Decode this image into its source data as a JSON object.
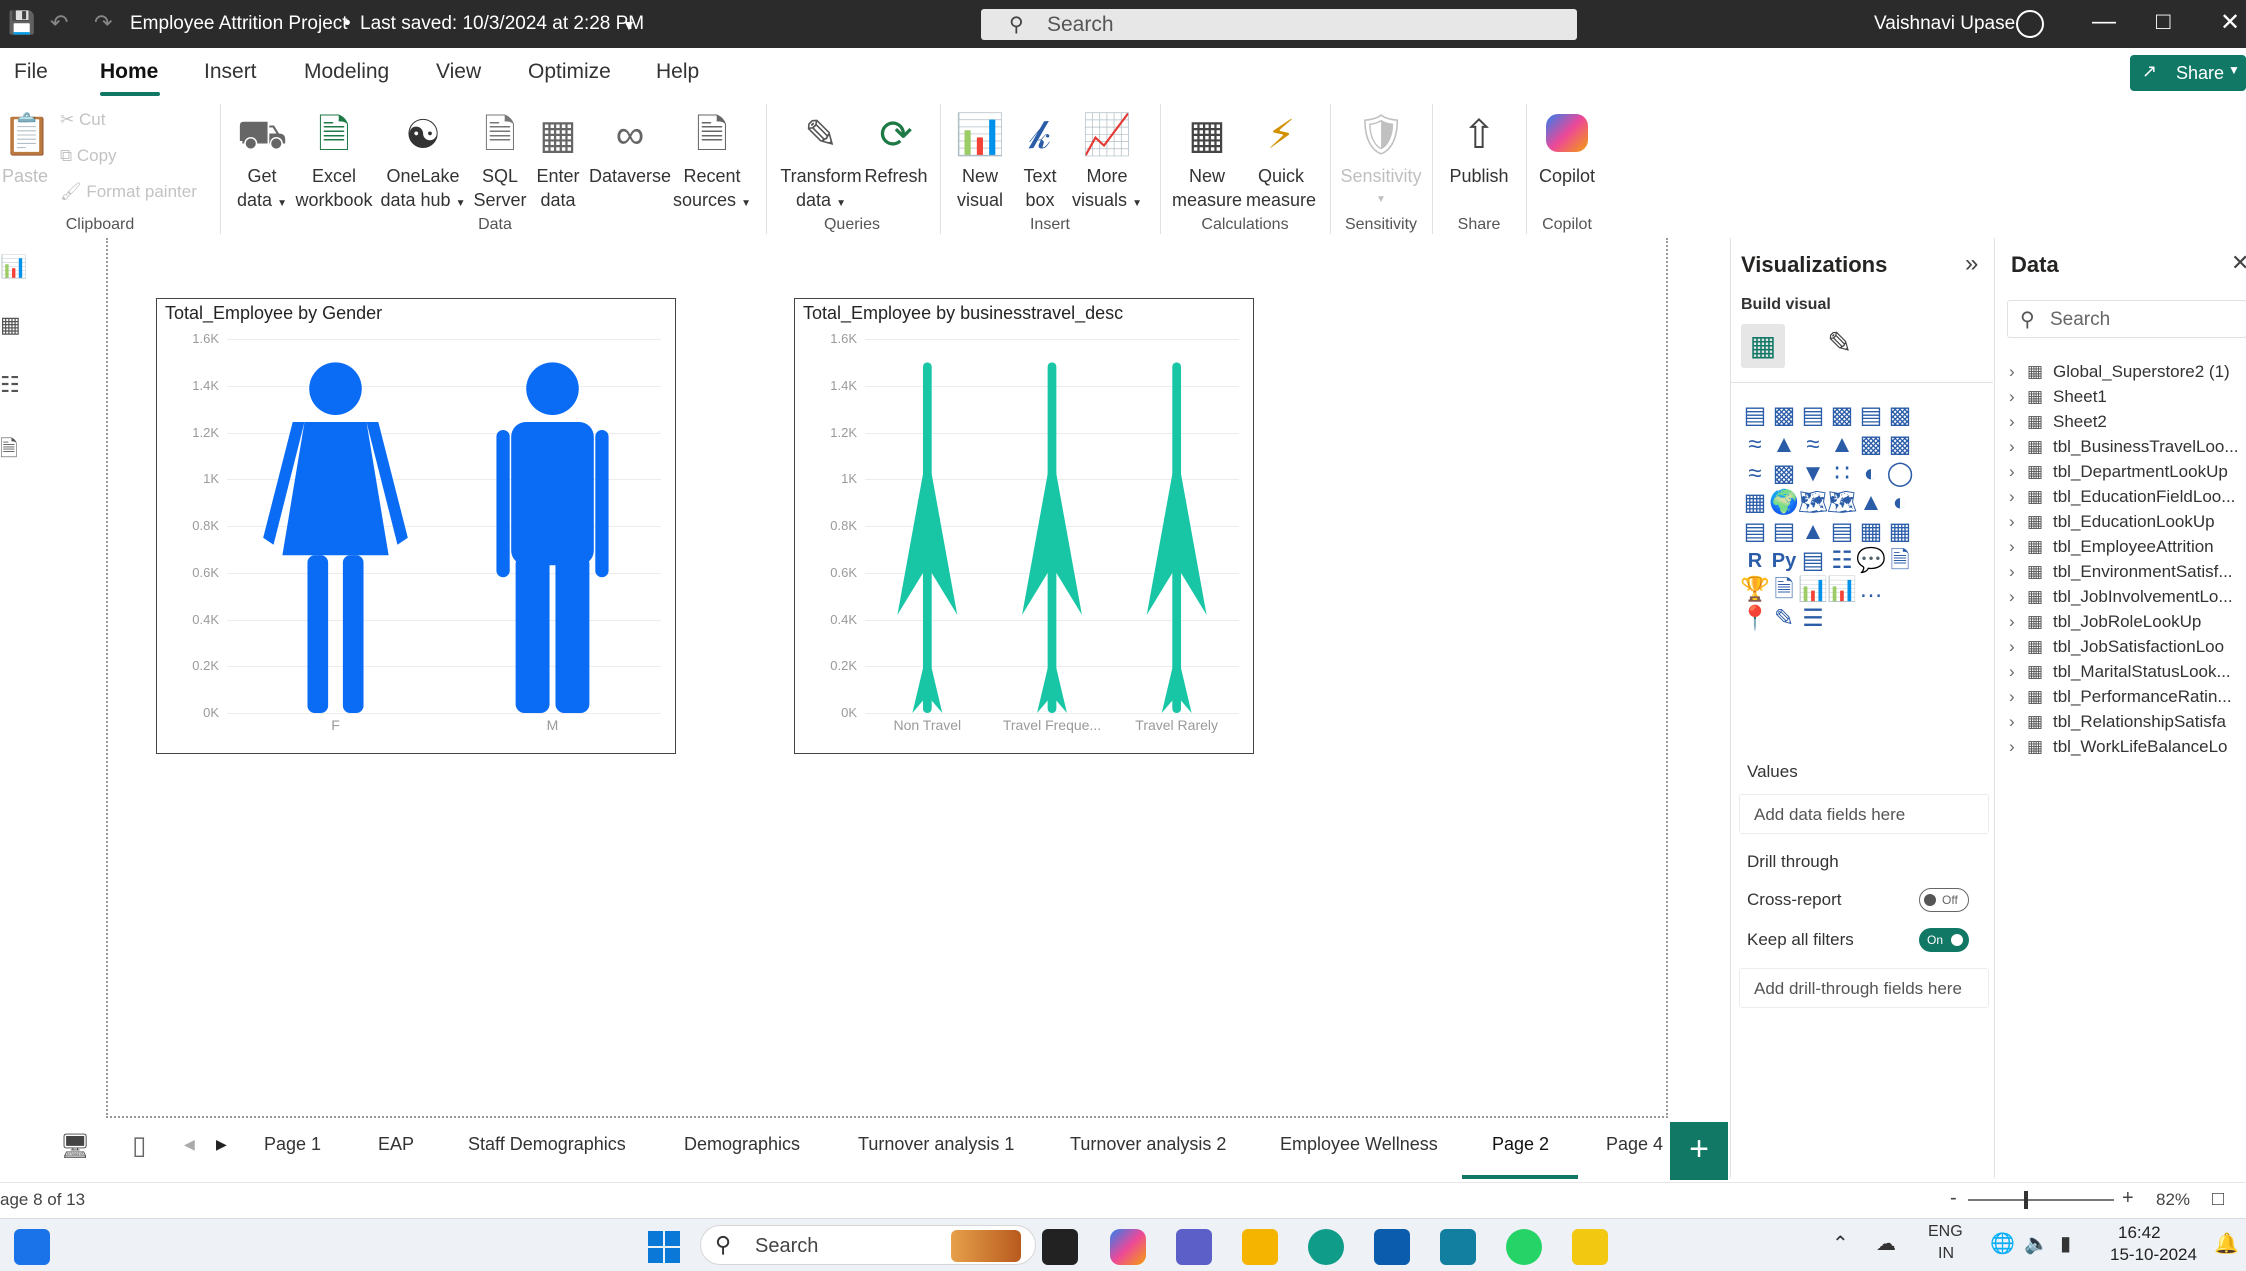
{
  "titlebar": {
    "document_title": "Employee Attrition Project",
    "saved_status": "Last saved: 10/3/2024 at 2:28 PM",
    "search_placeholder": "Search",
    "user_name": "Vaishnavi Upase"
  },
  "menu": {
    "items": [
      "File",
      "Home",
      "Insert",
      "Modeling",
      "View",
      "Optimize",
      "Help"
    ],
    "share_label": "Share"
  },
  "ribbon": {
    "clipboard": {
      "paste": "Paste",
      "cut": "Cut",
      "copy": "Copy",
      "format_painter": "Format painter",
      "group": "Clipboard"
    },
    "data": {
      "get_data": [
        "Get",
        "data"
      ],
      "excel": [
        "Excel",
        "workbook"
      ],
      "onelake": [
        "OneLake",
        "data hub"
      ],
      "sql": [
        "SQL",
        "Server"
      ],
      "enter": [
        "Enter",
        "data"
      ],
      "dataverse": [
        "Dataverse",
        ""
      ],
      "recent": [
        "Recent",
        "sources"
      ],
      "group": "Data"
    },
    "queries": {
      "transform": [
        "Transform",
        "data"
      ],
      "refresh": [
        "Refresh",
        ""
      ],
      "group": "Queries"
    },
    "insert": {
      "new_visual": [
        "New",
        "visual"
      ],
      "text_box": [
        "Text",
        "box"
      ],
      "more_visuals": [
        "More",
        "visuals"
      ],
      "group": "Insert"
    },
    "calculations": {
      "new_measure": [
        "New",
        "measure"
      ],
      "quick_measure": [
        "Quick",
        "measure"
      ],
      "group": "Calculations"
    },
    "sensitivity": {
      "label": "Sensitivity",
      "group": "Sensitivity"
    },
    "share": {
      "publish": "Publish",
      "group": "Share"
    },
    "copilot": {
      "label": "Copilot",
      "group": "Copilot"
    }
  },
  "visuals": [
    {
      "title": "Total_Employee by Gender",
      "chart_data": {
        "type": "bar",
        "categories": [
          "F",
          "M"
        ],
        "values": [
          1500,
          1500
        ],
        "yticks": [
          "0K",
          "0.2K",
          "0.4K",
          "0.6K",
          "0.8K",
          "1K",
          "1.2K",
          "1.4K",
          "1.6K"
        ],
        "ylim": [
          0,
          1600
        ],
        "colors": [
          "#0a6cf5",
          "#0a6cf5"
        ]
      }
    },
    {
      "title": "Total_Employee by businesstravel_desc",
      "chart_data": {
        "type": "bar",
        "categories": [
          "Non Travel",
          "Travel Freque...",
          "Travel Rarely"
        ],
        "values": [
          1500,
          1500,
          1500
        ],
        "yticks": [
          "0K",
          "0.2K",
          "0.4K",
          "0.6K",
          "0.8K",
          "1K",
          "1.2K",
          "1.4K",
          "1.6K"
        ],
        "ylim": [
          0,
          1600
        ],
        "colors": [
          "#18c6a6",
          "#18c6a6",
          "#18c6a6"
        ]
      }
    }
  ],
  "visualizations_pane": {
    "title": "Visualizations",
    "build_visual": "Build visual",
    "values_label": "Values",
    "values_placeholder": "Add data fields here",
    "drill_through": "Drill through",
    "cross_report": "Cross-report",
    "cross_report_state": "Off",
    "keep_filters": "Keep all filters",
    "keep_filters_state": "On",
    "drill_placeholder": "Add drill-through fields here"
  },
  "data_pane": {
    "title": "Data",
    "search_placeholder": "Search",
    "tables": [
      "Global_Superstore2 (1)",
      "Sheet1",
      "Sheet2",
      "tbl_BusinessTravelLoo...",
      "tbl_DepartmentLookUp",
      "tbl_EducationFieldLoo...",
      "tbl_EducationLookUp",
      "tbl_EmployeeAttrition",
      "tbl_EnvironmentSatisf...",
      "tbl_JobInvolvementLo...",
      "tbl_JobRoleLookUp",
      "tbl_JobSatisfactionLoo",
      "tbl_MaritalStatusLook...",
      "tbl_PerformanceRatin...",
      "tbl_RelationshipSatisfa",
      "tbl_WorkLifeBalanceLo"
    ]
  },
  "page_tabs": [
    "Page 1",
    "EAP",
    "Staff Demographics",
    "Demographics",
    "Turnover analysis 1",
    "Turnover analysis 2",
    "Employee Wellness",
    "Page 2",
    "Page 4"
  ],
  "active_tab": "Page 2",
  "status": {
    "page_indicator": "age 8 of 13",
    "zoom": "82%"
  },
  "taskbar": {
    "search": "Search",
    "lang": [
      "ENG",
      "IN"
    ],
    "time": "16:42",
    "date": "15-10-2024"
  }
}
